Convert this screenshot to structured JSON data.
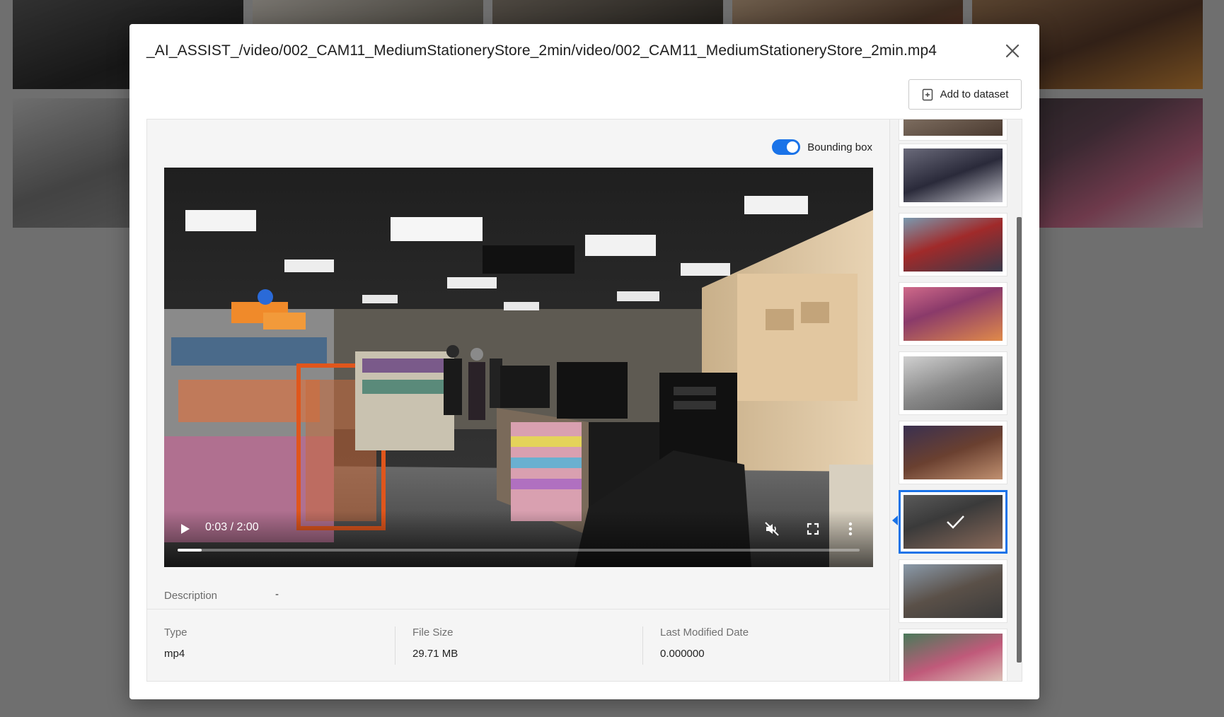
{
  "modal": {
    "title": "_AI_ASSIST_/video/002_CAM11_MediumStationeryStore_2min/video/002_CAM11_MediumStationeryStore_2min.mp4",
    "add_to_dataset_label": "Add to dataset"
  },
  "player": {
    "bounding_box_label": "Bounding box",
    "bounding_box_enabled": true,
    "time_display": "0:03 / 2:00",
    "progress_fraction": 0.035,
    "muted": true
  },
  "details": {
    "description_label": "Description",
    "description_value": "-",
    "type_label": "Type",
    "type_value": "mp4",
    "file_size_label": "File Size",
    "file_size_value": "29.71 MB",
    "last_modified_label": "Last Modified Date",
    "last_modified_value": "0.000000"
  },
  "thumbnails": {
    "selected_index": 6,
    "count": 9
  },
  "colors": {
    "accent": "#1a73e8",
    "overlay": "#6f6f6f"
  },
  "icons": {
    "close": "close-icon",
    "add_dataset": "add-file-icon",
    "play": "play-icon",
    "mute": "volume-muted-icon",
    "fullscreen": "fullscreen-icon",
    "more": "more-vertical-icon",
    "check": "check-icon"
  }
}
